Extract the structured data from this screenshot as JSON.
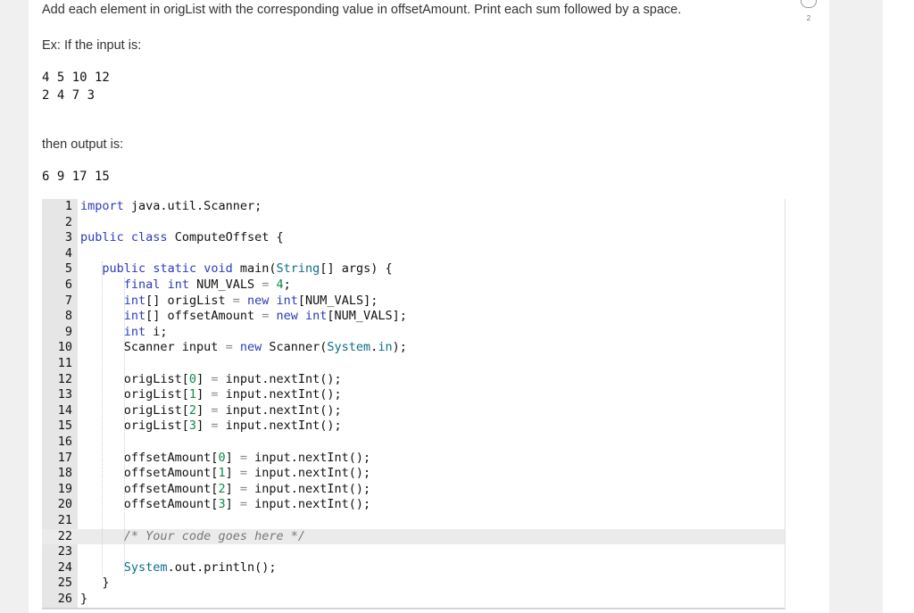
{
  "prompt": "Add each element in origList with the corresponding value in offsetAmount. Print each sum followed by a space.",
  "example": {
    "ex_label": "Ex: If the input is:",
    "input_lines": [
      "4 5 10 12",
      "2 4 7 3"
    ],
    "then_label": "then output is:",
    "output_line": "6 9 17 15"
  },
  "progress": {
    "count": "2"
  },
  "editor": {
    "active_line": 22,
    "lines": [
      {
        "n": "1",
        "code": "import java.util.Scanner;"
      },
      {
        "n": "2",
        "code": ""
      },
      {
        "n": "3",
        "code": "public class ComputeOffset {"
      },
      {
        "n": "4",
        "code": ""
      },
      {
        "n": "5",
        "code": "   public static void main(String[] args) {"
      },
      {
        "n": "6",
        "code": "      final int NUM_VALS = 4;"
      },
      {
        "n": "7",
        "code": "      int[] origList = new int[NUM_VALS];"
      },
      {
        "n": "8",
        "code": "      int[] offsetAmount = new int[NUM_VALS];"
      },
      {
        "n": "9",
        "code": "      int i;"
      },
      {
        "n": "10",
        "code": "      Scanner input = new Scanner(System.in);"
      },
      {
        "n": "11",
        "code": ""
      },
      {
        "n": "12",
        "code": "      origList[0] = input.nextInt();"
      },
      {
        "n": "13",
        "code": "      origList[1] = input.nextInt();"
      },
      {
        "n": "14",
        "code": "      origList[2] = input.nextInt();"
      },
      {
        "n": "15",
        "code": "      origList[3] = input.nextInt();"
      },
      {
        "n": "16",
        "code": ""
      },
      {
        "n": "17",
        "code": "      offsetAmount[0] = input.nextInt();"
      },
      {
        "n": "18",
        "code": "      offsetAmount[1] = input.nextInt();"
      },
      {
        "n": "19",
        "code": "      offsetAmount[2] = input.nextInt();"
      },
      {
        "n": "20",
        "code": "      offsetAmount[3] = input.nextInt();"
      },
      {
        "n": "21",
        "code": ""
      },
      {
        "n": "22",
        "code": "      /* Your code goes here */"
      },
      {
        "n": "23",
        "code": ""
      },
      {
        "n": "24",
        "code": "      System.out.println();"
      },
      {
        "n": "25",
        "code": "   }"
      },
      {
        "n": "26",
        "code": "}"
      }
    ]
  }
}
